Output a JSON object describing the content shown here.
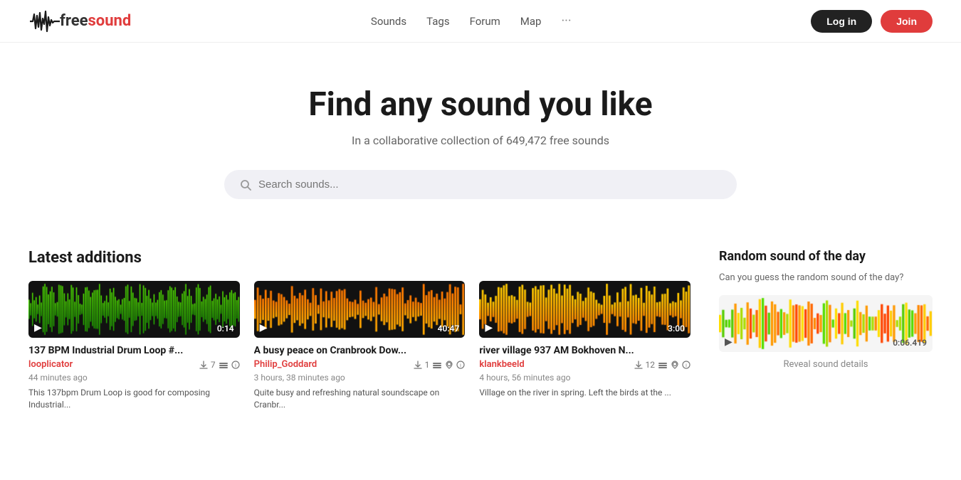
{
  "nav": {
    "logo_free": "free",
    "logo_sound": "sound",
    "links": [
      {
        "label": "Sounds",
        "href": "#"
      },
      {
        "label": "Tags",
        "href": "#"
      },
      {
        "label": "Forum",
        "href": "#"
      },
      {
        "label": "Map",
        "href": "#"
      }
    ],
    "login_label": "Log in",
    "join_label": "Join"
  },
  "hero": {
    "heading": "Find any sound you like",
    "subtext": "In a collaborative collection of 649,472 free sounds",
    "search_placeholder": "Search sounds..."
  },
  "latest": {
    "section_title": "Latest additions",
    "cards": [
      {
        "title": "137 BPM Industrial Drum Loop #...",
        "author": "looplicator",
        "duration": "0:14",
        "downloads": "7",
        "time_ago": "44 minutes ago",
        "description": "This 137bpm Drum Loop is good for composing Industrial...",
        "waveform_color": "#44dd00",
        "waveform_color2": "#22aa00",
        "bg_color": "#1a1a1a"
      },
      {
        "title": "A busy peace on Cranbrook Dow...",
        "author": "Philip_Goddard",
        "duration": "40:47",
        "downloads": "1",
        "time_ago": "3 hours, 38 minutes ago",
        "description": "Quite busy and refreshing natural soundscape on Cranbr...",
        "waveform_color": "#ff6600",
        "waveform_color2": "#ffaa00",
        "bg_color": "#1a1a1a"
      },
      {
        "title": "river village 937 AM Bokhoven N...",
        "author": "klankbeeld",
        "duration": "3:00",
        "downloads": "12",
        "time_ago": "4 hours, 56 minutes ago",
        "description": "Village on the river in spring. Left the birds at the ...",
        "waveform_color": "#ffcc00",
        "waveform_color2": "#ff8800",
        "bg_color": "#1a1a1a"
      }
    ]
  },
  "random": {
    "title": "Random sound of the day",
    "description": "Can you guess the random sound of the day?",
    "duration": "0:06.419",
    "reveal_label": "Reveal sound details"
  }
}
